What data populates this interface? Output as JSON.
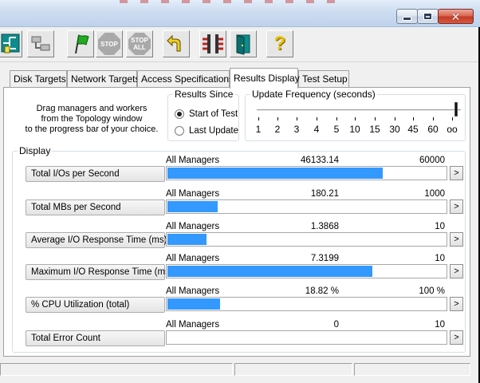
{
  "toolbar": {
    "stop_label": "STOP",
    "stop_all_label_1": "STOP",
    "stop_all_label_2": "ALL",
    "help_glyph": "?"
  },
  "window_controls": {
    "close_glyph": "✕"
  },
  "tabs": [
    {
      "label": "Disk Targets"
    },
    {
      "label": "Network Targets"
    },
    {
      "label": "Access Specifications"
    },
    {
      "label": "Results Display",
      "active": true
    },
    {
      "label": "Test Setup"
    }
  ],
  "hint": {
    "line1": "Drag managers and workers",
    "line2": "from the Topology window",
    "line3": "to the progress bar of your choice."
  },
  "results_since": {
    "legend": "Results Since",
    "options": [
      {
        "label": "Start of Test",
        "selected": true
      },
      {
        "label": "Last Update",
        "selected": false
      }
    ]
  },
  "update_frequency": {
    "legend": "Update Frequency (seconds)",
    "ticks": [
      "1",
      "2",
      "3",
      "4",
      "5",
      "10",
      "15",
      "30",
      "45",
      "60",
      "oo"
    ],
    "selected": "oo"
  },
  "display": {
    "legend": "Display",
    "more_glyph": ">",
    "rows": [
      {
        "button": "Total I/Os per Second",
        "manager": "All Managers",
        "value": "46133.14",
        "max": "60000",
        "fill": 0.7689
      },
      {
        "button": "Total MBs per Second",
        "manager": "All Managers",
        "value": "180.21",
        "max": "1000",
        "fill": 0.1802
      },
      {
        "button": "Average I/O Response Time (ms)",
        "manager": "All Managers",
        "value": "1.3868",
        "max": "10",
        "fill": 0.1387
      },
      {
        "button": "Maximum I/O Response Time (ms)",
        "manager": "All Managers",
        "value": "7.3199",
        "max": "10",
        "fill": 0.732
      },
      {
        "button": "% CPU Utilization (total)",
        "manager": "All Managers",
        "value": "18.82 %",
        "max": "100 %",
        "fill": 0.1882
      },
      {
        "button": "Total Error Count",
        "manager": "All Managers",
        "value": "0",
        "max": "10",
        "fill": 0
      }
    ]
  },
  "colors": {
    "bar_fill": "#3399ff",
    "topology_icon": "#0e8c8c",
    "flag_green": "#22aa22"
  }
}
